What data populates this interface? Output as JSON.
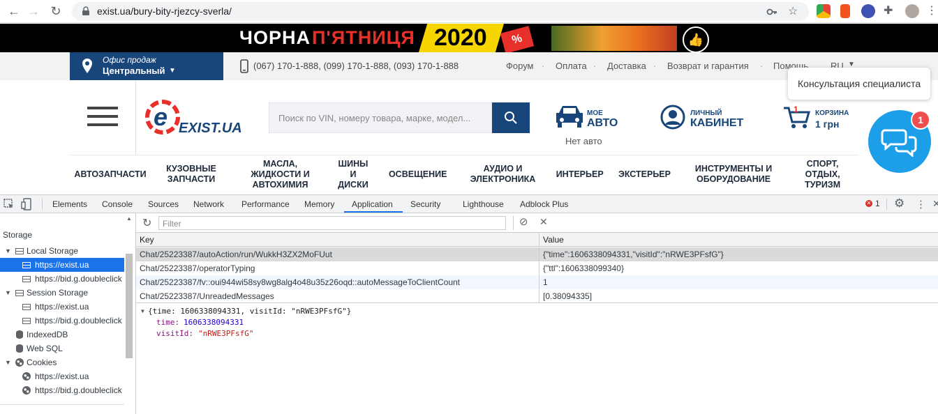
{
  "browser": {
    "url": "exist.ua/bury-bity-rjezcy-sverla/"
  },
  "promo": {
    "text_white": "ЧОРНА",
    "text_red": "П'ЯТНИЦЯ",
    "year": "2020",
    "badge": "%"
  },
  "topbar": {
    "office_label": "Офис продаж",
    "office_value": "Центральный",
    "phones": "(067) 170-1-888,  (099) 170-1-888,  (093) 170-1-888",
    "links": [
      "Форум",
      "Оплата",
      "Доставка",
      "Возврат и гарантия",
      "Помощь",
      "RU"
    ]
  },
  "header": {
    "logo": "EXIST.UA",
    "search_placeholder": "Поиск по VIN, номеру товара, марке, модел...",
    "car_label_small": "МОЕ",
    "car_label_big": "АВТО",
    "car_status": "Нет авто",
    "cabinet_small": "ЛИЧНЫЙ",
    "cabinet_big": "КАБИНЕТ",
    "cart_small": "КОРЗИНА",
    "cart_big": "1 грн",
    "cart_count": "1",
    "consult_tooltip": "Консультация специалиста",
    "chat_badge": "1"
  },
  "categories": [
    "АВТОЗАПЧАСТИ",
    "КУЗОВНЫЕ\nЗАПЧАСТИ",
    "МАСЛА,\nЖИДКОСТИ И\nАВТОХИМИЯ",
    "ШИНЫ\nИ\nДИСКИ",
    "ОСВЕЩЕНИЕ",
    "АУДИО И\nЭЛЕКТРОНИКА",
    "ИНТЕРЬЕР",
    "ЭКСТЕРЬЕР",
    "ИНСТРУМЕНТЫ И\nОБОРУДОВАНИЕ",
    "СПОРТ,\nОТДЫХ,\nТУРИЗМ"
  ],
  "devtools": {
    "tabs": [
      "Elements",
      "Console",
      "Sources",
      "Network",
      "Performance",
      "Memory",
      "Application",
      "Security",
      "Lighthouse",
      "Adblock Plus"
    ],
    "active_tab": "Application",
    "error_count": "1",
    "sidebar": {
      "section": "Storage",
      "items": [
        {
          "label": "Local Storage",
          "level": 1,
          "icon": "table-icon",
          "expand": "▼"
        },
        {
          "label": "https://exist.ua",
          "level": 2,
          "icon": "table-icon",
          "selected": true
        },
        {
          "label": "https://bid.g.doubleclick",
          "level": 2,
          "icon": "table-icon"
        },
        {
          "label": "Session Storage",
          "level": 1,
          "icon": "table-icon",
          "expand": "▼"
        },
        {
          "label": "https://exist.ua",
          "level": 2,
          "icon": "table-icon"
        },
        {
          "label": "https://bid.g.doubleclick",
          "level": 2,
          "icon": "table-icon"
        },
        {
          "label": "IndexedDB",
          "level": 1,
          "icon": "database-icon"
        },
        {
          "label": "Web SQL",
          "level": 1,
          "icon": "database-icon"
        },
        {
          "label": "Cookies",
          "level": 1,
          "icon": "cookie-icon",
          "expand": "▼"
        },
        {
          "label": "https://exist.ua",
          "level": 2,
          "icon": "cookie-icon"
        },
        {
          "label": "https://bid.g.doubleclick",
          "level": 2,
          "icon": "cookie-icon"
        }
      ]
    },
    "filter_placeholder": "Filter",
    "table": {
      "columns": [
        "Key",
        "Value"
      ],
      "rows": [
        {
          "key": "Chat/25223387/autoAction/run/WukkH3ZX2MoFUut",
          "value": "{\"time\":1606338094331,\"visitId\":\"nRWE3PFsfG\"}"
        },
        {
          "key": "Chat/25223387/operatorTyping",
          "value": "{\"ttl\":1606338099340}"
        },
        {
          "key": "Chat/25223387/fv::oui944wi58sy8wg8alg4o48u35z26oqd::autoMessageToClientCount",
          "value": "1"
        },
        {
          "key": "Chat/25223387/UnreadedMessages",
          "value": "[0.38094335]"
        }
      ]
    },
    "preview": {
      "summary": "{time: 1606338094331, visitId: \"nRWE3PFsfG\"}",
      "time_key": "time:",
      "time_val": "1606338094331",
      "visit_key": "visitId:",
      "visit_val": "\"nRWE3PFsfG\""
    }
  },
  "colors": {
    "brand_blue": "#18457a",
    "brand_red": "#e8302b",
    "chat_blue": "#1d9ee8",
    "promo_yellow": "#f7d600",
    "selected_row": "#1a73e8"
  }
}
